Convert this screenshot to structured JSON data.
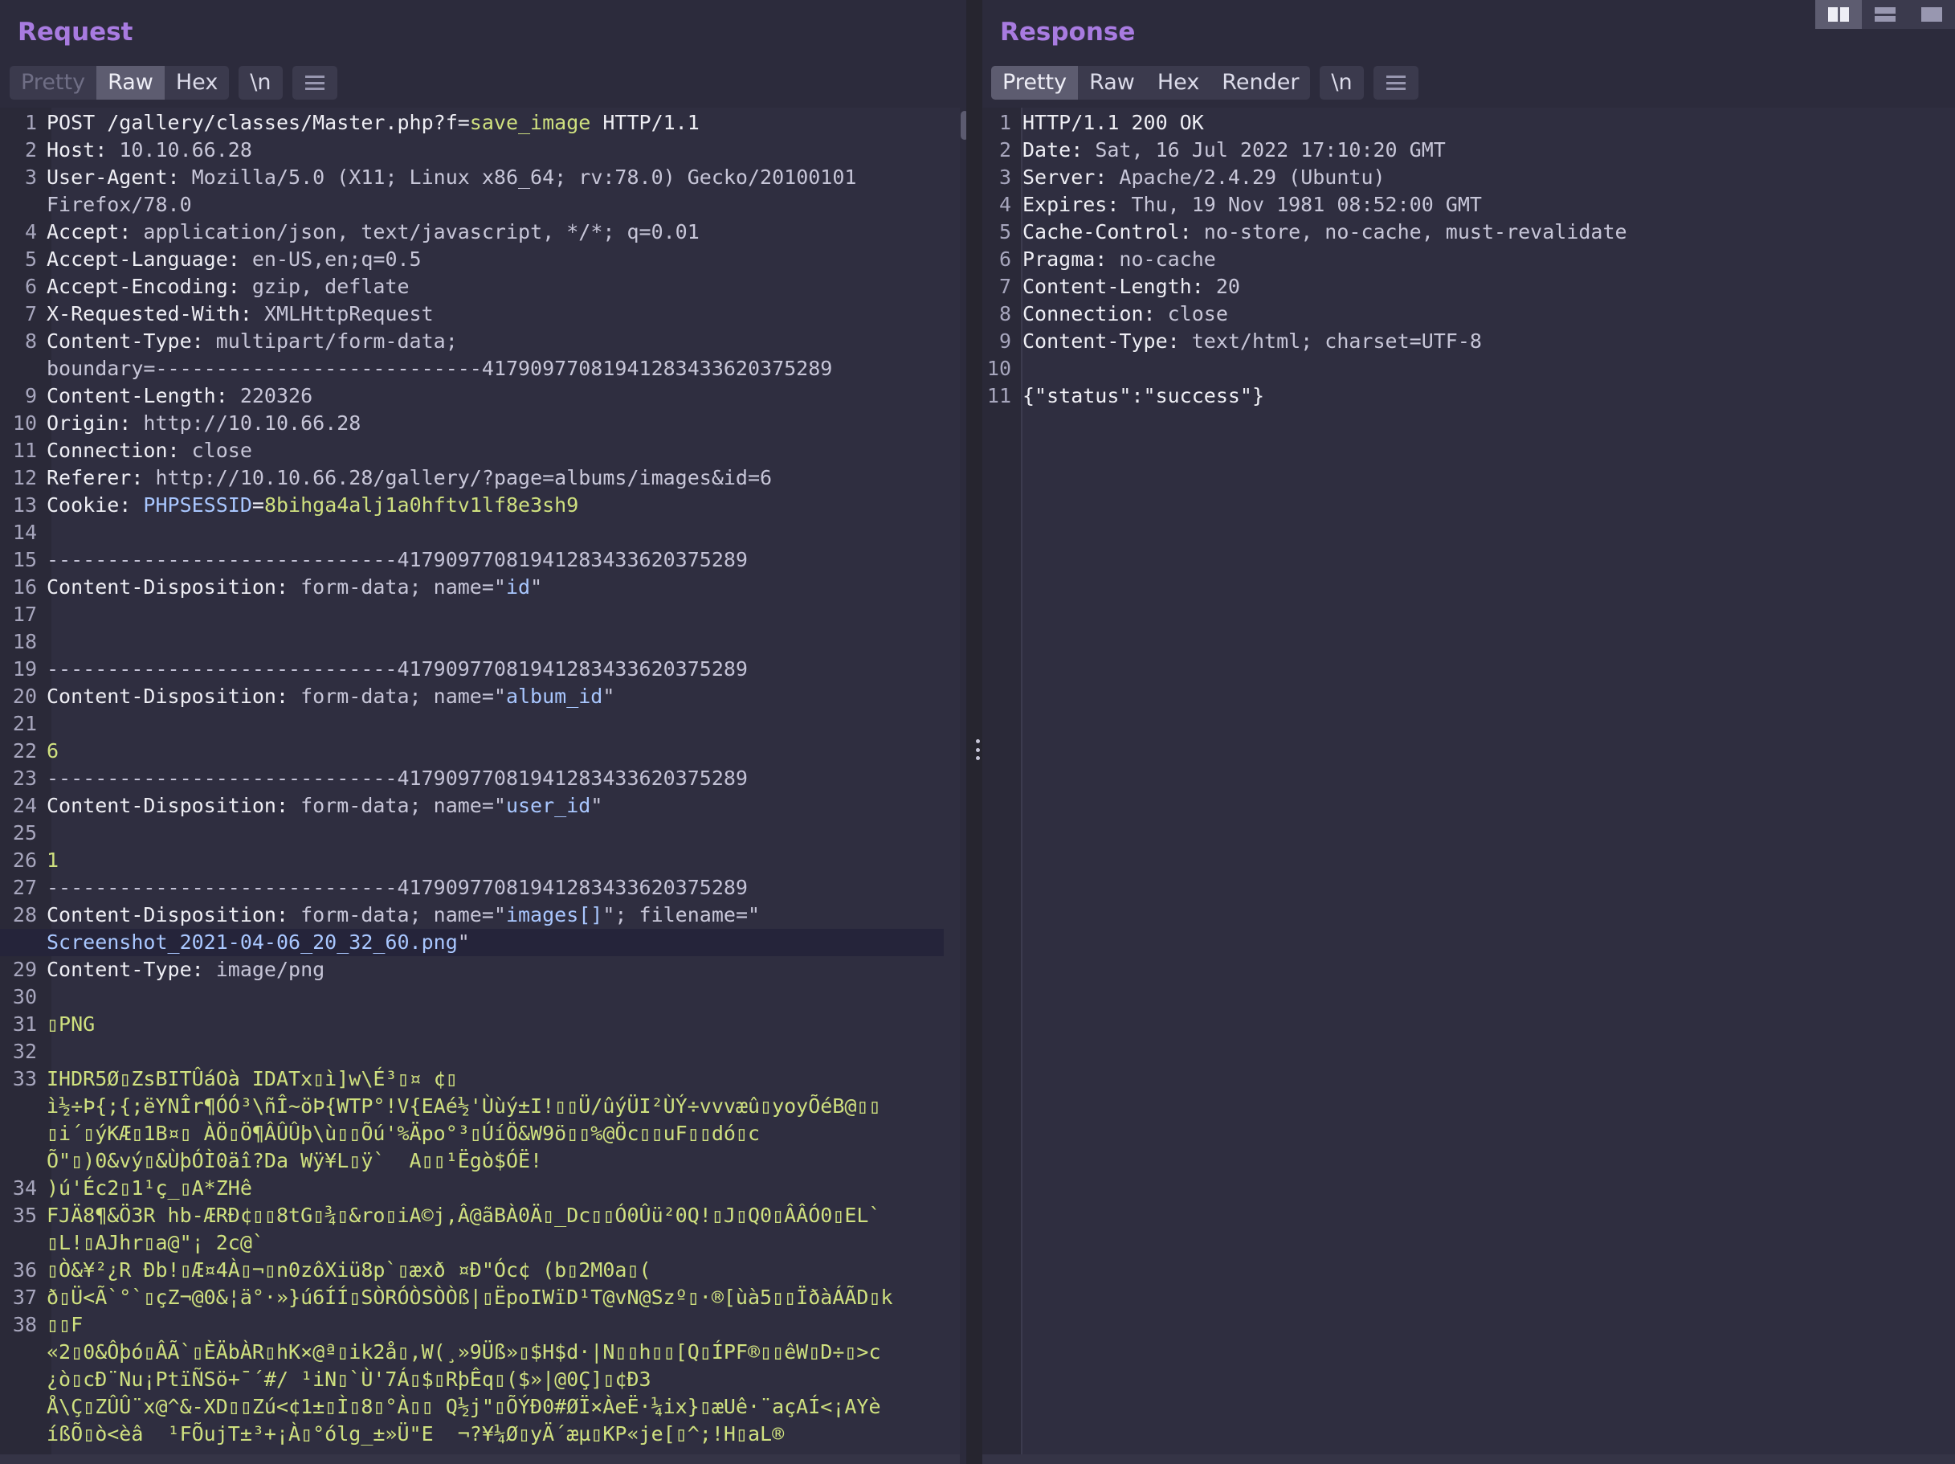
{
  "view_toggle": [
    "split-columns",
    "split-rows",
    "single"
  ],
  "request": {
    "title": "Request",
    "tabs": [
      {
        "label": "Pretty",
        "state": "disabled"
      },
      {
        "label": "Raw",
        "state": "active"
      },
      {
        "label": "Hex",
        "state": "normal"
      }
    ],
    "newline_label": "\\n",
    "menu_icon": "hamburger-icon",
    "lines": [
      {
        "n": "1",
        "parts": [
          [
            "k",
            "POST /gallery/classes/Master.php?f="
          ],
          [
            "g",
            "save_image"
          ],
          [
            "k",
            " HTTP/1.1"
          ]
        ]
      },
      {
        "n": "2",
        "parts": [
          [
            "k",
            "Host: "
          ],
          [
            "v",
            "10.10.66.28"
          ]
        ]
      },
      {
        "n": "3",
        "parts": [
          [
            "k",
            "User-Agent: "
          ],
          [
            "v",
            "Mozilla/5.0 (X11; Linux x86_64; rv:78.0) Gecko/20100101"
          ]
        ]
      },
      {
        "n": "",
        "parts": [
          [
            "v",
            "Firefox/78.0"
          ]
        ]
      },
      {
        "n": "4",
        "parts": [
          [
            "k",
            "Accept: "
          ],
          [
            "v",
            "application/json, text/javascript, */*; q=0.01"
          ]
        ]
      },
      {
        "n": "5",
        "parts": [
          [
            "k",
            "Accept-Language: "
          ],
          [
            "v",
            "en-US,en;q=0.5"
          ]
        ]
      },
      {
        "n": "6",
        "parts": [
          [
            "k",
            "Accept-Encoding: "
          ],
          [
            "v",
            "gzip, deflate"
          ]
        ]
      },
      {
        "n": "7",
        "parts": [
          [
            "k",
            "X-Requested-With: "
          ],
          [
            "v",
            "XMLHttpRequest"
          ]
        ]
      },
      {
        "n": "8",
        "parts": [
          [
            "k",
            "Content-Type: "
          ],
          [
            "v",
            "multipart/form-data;"
          ]
        ]
      },
      {
        "n": "",
        "parts": [
          [
            "v",
            "boundary=---------------------------417909770819412834336203752​89"
          ]
        ]
      },
      {
        "n": "9",
        "parts": [
          [
            "k",
            "Content-Length: "
          ],
          [
            "v",
            "220326"
          ]
        ]
      },
      {
        "n": "10",
        "parts": [
          [
            "k",
            "Origin: "
          ],
          [
            "v",
            "http://10.10.66.28"
          ]
        ]
      },
      {
        "n": "11",
        "parts": [
          [
            "k",
            "Connection: "
          ],
          [
            "v",
            "close"
          ]
        ]
      },
      {
        "n": "12",
        "parts": [
          [
            "k",
            "Referer: "
          ],
          [
            "v",
            "http://10.10.66.28/gallery/?page=albums/images&id=6"
          ]
        ]
      },
      {
        "n": "13",
        "parts": [
          [
            "k",
            "Cookie: "
          ],
          [
            "s",
            "PHPSESSID"
          ],
          [
            "k",
            "="
          ],
          [
            "g",
            "8bihga4alj1a0hftv1lf8e3sh9"
          ]
        ]
      },
      {
        "n": "14",
        "parts": []
      },
      {
        "n": "15",
        "parts": [
          [
            "sep",
            "-----------------------------41790977081941283433620375289"
          ]
        ]
      },
      {
        "n": "16",
        "parts": [
          [
            "k",
            "Content-Disposition: "
          ],
          [
            "v",
            "form-data; name=\""
          ],
          [
            "s",
            "id"
          ],
          [
            "v",
            "\""
          ]
        ]
      },
      {
        "n": "17",
        "parts": []
      },
      {
        "n": "18",
        "parts": []
      },
      {
        "n": "19",
        "parts": [
          [
            "sep",
            "-----------------------------41790977081941283433620375289"
          ]
        ]
      },
      {
        "n": "20",
        "parts": [
          [
            "k",
            "Content-Disposition: "
          ],
          [
            "v",
            "form-data; name=\""
          ],
          [
            "s",
            "album_id"
          ],
          [
            "v",
            "\""
          ]
        ]
      },
      {
        "n": "21",
        "parts": []
      },
      {
        "n": "22",
        "parts": [
          [
            "g",
            "6"
          ]
        ]
      },
      {
        "n": "23",
        "parts": [
          [
            "sep",
            "-----------------------------41790977081941283433620375289"
          ]
        ]
      },
      {
        "n": "24",
        "parts": [
          [
            "k",
            "Content-Disposition: "
          ],
          [
            "v",
            "form-data; name=\""
          ],
          [
            "s",
            "user_id"
          ],
          [
            "v",
            "\""
          ]
        ]
      },
      {
        "n": "25",
        "parts": []
      },
      {
        "n": "26",
        "parts": [
          [
            "g",
            "1"
          ]
        ]
      },
      {
        "n": "27",
        "parts": [
          [
            "sep",
            "-----------------------------41790977081941283433620375289"
          ]
        ]
      },
      {
        "n": "28",
        "parts": [
          [
            "k",
            "Content-Disposition: "
          ],
          [
            "v",
            "form-data; name=\""
          ],
          [
            "s",
            "images[]"
          ],
          [
            "v",
            "\"; filename=\""
          ]
        ]
      },
      {
        "n": "",
        "hl": true,
        "parts": [
          [
            "s",
            "Screenshot_2021-04-06_20_32_60.png"
          ],
          [
            "v",
            "\""
          ]
        ]
      },
      {
        "n": "29",
        "parts": [
          [
            "k",
            "Content-Type: "
          ],
          [
            "v",
            "image/png"
          ]
        ]
      },
      {
        "n": "30",
        "parts": []
      },
      {
        "n": "31",
        "parts": [
          [
            "g",
            "▯PNG"
          ]
        ]
      },
      {
        "n": "32",
        "parts": []
      },
      {
        "n": "33",
        "parts": [
          [
            "g",
            "IHDR5Ø▯ZsBITÛáOà IDATx▯ì]w\\É³▯¤ ¢▯"
          ]
        ]
      },
      {
        "n": "",
        "parts": [
          [
            "g",
            "ì½÷Þ{;{;ëYNÎr¶ÓÓ³\\ñÎ~öÞ{WTP°!V{EAé½'Ùùý±I!▯▯Ü/ûýÜI²ÙÝ÷vvvæû▯yoyÕéB@▯▯"
          ]
        ]
      },
      {
        "n": "",
        "parts": [
          [
            "g",
            "▯i´▯ýKÆ▯1B¤▯ ÀÖ▯Ö¶ÂÛÛþ\\ù▯▯Õú'%Äpo°³▯ÚíÖ&W9ö▯▯%@Öc▯▯uF▯▯dó▯c"
          ]
        ]
      },
      {
        "n": "",
        "parts": [
          [
            "g",
            "Õ\"▯)0&vý▯&ÙþÓÌ0äî?Da Wÿ¥L▯ÿ`  A▯▯¹Ëgò$ÓË!"
          ]
        ]
      },
      {
        "n": "34",
        "parts": [
          [
            "g",
            ")ú'Éc2▯1¹ç_▯A*ZHê"
          ]
        ]
      },
      {
        "n": "35",
        "parts": [
          [
            "g",
            "FJÄ8¶&Ö3R hb-ÆRÐ¢▯▯8tG▯¾▯&ro▯iA©j,Â@ãBÀ0Ä▯_Dc▯▯Ó0Ûü²0Q!▯J▯Q0▯ÂÂÓ0▯EL`"
          ]
        ]
      },
      {
        "n": "",
        "parts": [
          [
            "g",
            "▯L!▯AJhr▯a@\"¡ 2c@`"
          ]
        ]
      },
      {
        "n": "36",
        "parts": [
          [
            "g",
            "▯Ò&¥²¿R Ðb!▯Æ¤4À▯¬▯n0zôXiü8p`▯æxð ¤Ð\"Óc¢ (b▯2M0a▯("
          ]
        ]
      },
      {
        "n": "37",
        "parts": [
          [
            "g",
            "ð▯Ü<Ã`°`▯çZ¬@0&¦ä°·»}ú6ÍÍ▯SÒRÓÒSÒÒß|▯ËpoIWïD¹T@vN@Szº▯·®[ùà5▯▯ÏðàÁÃD▯k"
          ]
        ]
      },
      {
        "n": "38",
        "parts": [
          [
            "g",
            "▯▯F"
          ]
        ]
      },
      {
        "n": "",
        "parts": [
          [
            "g",
            "«2▯0&Ôþó▯ÂÃ`▯ÈÄbÀR▯hK×@ª▯ik2å▯,W(¸»9Üß»▯$H$d·|N▯▯h▯▯[Q▯ÍPF®▯▯êW▯D÷▯>c"
          ]
        ]
      },
      {
        "n": "",
        "parts": [
          [
            "g",
            "¿ò▯cÐ¨Nu¡PtïÑSö+¯´#/ ¹iN▯`Ù'7Á▯$▯RþÊq▯($»|@0Ç]▯¢Ð3"
          ]
        ]
      },
      {
        "n": "",
        "parts": [
          [
            "g",
            "Å\\Ç▯ZÛÛ¨x@^&-XD▯▯Zú<¢1±▯Ì▯8▯°À▯▯ Q½j\"▯ÕÝÐ0#ØÏ×ÀeË·¼ix}▯æUê·¨açAÍ<¡AYè"
          ]
        ]
      },
      {
        "n": "",
        "parts": [
          [
            "g",
            "íßÕ▯ò<èâ  ¹FÕujT±³+¡À▯°ólg_±»Ü\"E  ¬?¥¼Ø▯yÄ´æµ▯KP«je[▯^;!H▯aL®"
          ]
        ]
      }
    ]
  },
  "response": {
    "title": "Response",
    "tabs": [
      {
        "label": "Pretty",
        "state": "active"
      },
      {
        "label": "Raw",
        "state": "normal"
      },
      {
        "label": "Hex",
        "state": "normal"
      },
      {
        "label": "Render",
        "state": "normal"
      }
    ],
    "newline_label": "\\n",
    "menu_icon": "hamburger-icon",
    "lines": [
      {
        "n": "1",
        "parts": [
          [
            "k",
            "HTTP/1.1 200 OK"
          ]
        ]
      },
      {
        "n": "2",
        "parts": [
          [
            "k",
            "Date: "
          ],
          [
            "v",
            "Sat, 16 Jul 2022 17:10:20 GMT"
          ]
        ]
      },
      {
        "n": "3",
        "parts": [
          [
            "k",
            "Server: "
          ],
          [
            "v",
            "Apache/2.4.29 (Ubuntu)"
          ]
        ]
      },
      {
        "n": "4",
        "parts": [
          [
            "k",
            "Expires: "
          ],
          [
            "v",
            "Thu, 19 Nov 1981 08:52:00 GMT"
          ]
        ]
      },
      {
        "n": "5",
        "parts": [
          [
            "k",
            "Cache-Control: "
          ],
          [
            "v",
            "no-store, no-cache, must-revalidate"
          ]
        ]
      },
      {
        "n": "6",
        "parts": [
          [
            "k",
            "Pragma: "
          ],
          [
            "v",
            "no-cache"
          ]
        ]
      },
      {
        "n": "7",
        "parts": [
          [
            "k",
            "Content-Length: "
          ],
          [
            "v",
            "20"
          ]
        ]
      },
      {
        "n": "8",
        "parts": [
          [
            "k",
            "Connection: "
          ],
          [
            "v",
            "close"
          ]
        ]
      },
      {
        "n": "9",
        "parts": [
          [
            "k",
            "Content-Type: "
          ],
          [
            "v",
            "text/html; charset=UTF-8"
          ]
        ]
      },
      {
        "n": "10",
        "parts": []
      },
      {
        "n": "11",
        "parts": [
          [
            "k",
            "{\"status\":\"success\"}"
          ]
        ]
      }
    ]
  }
}
